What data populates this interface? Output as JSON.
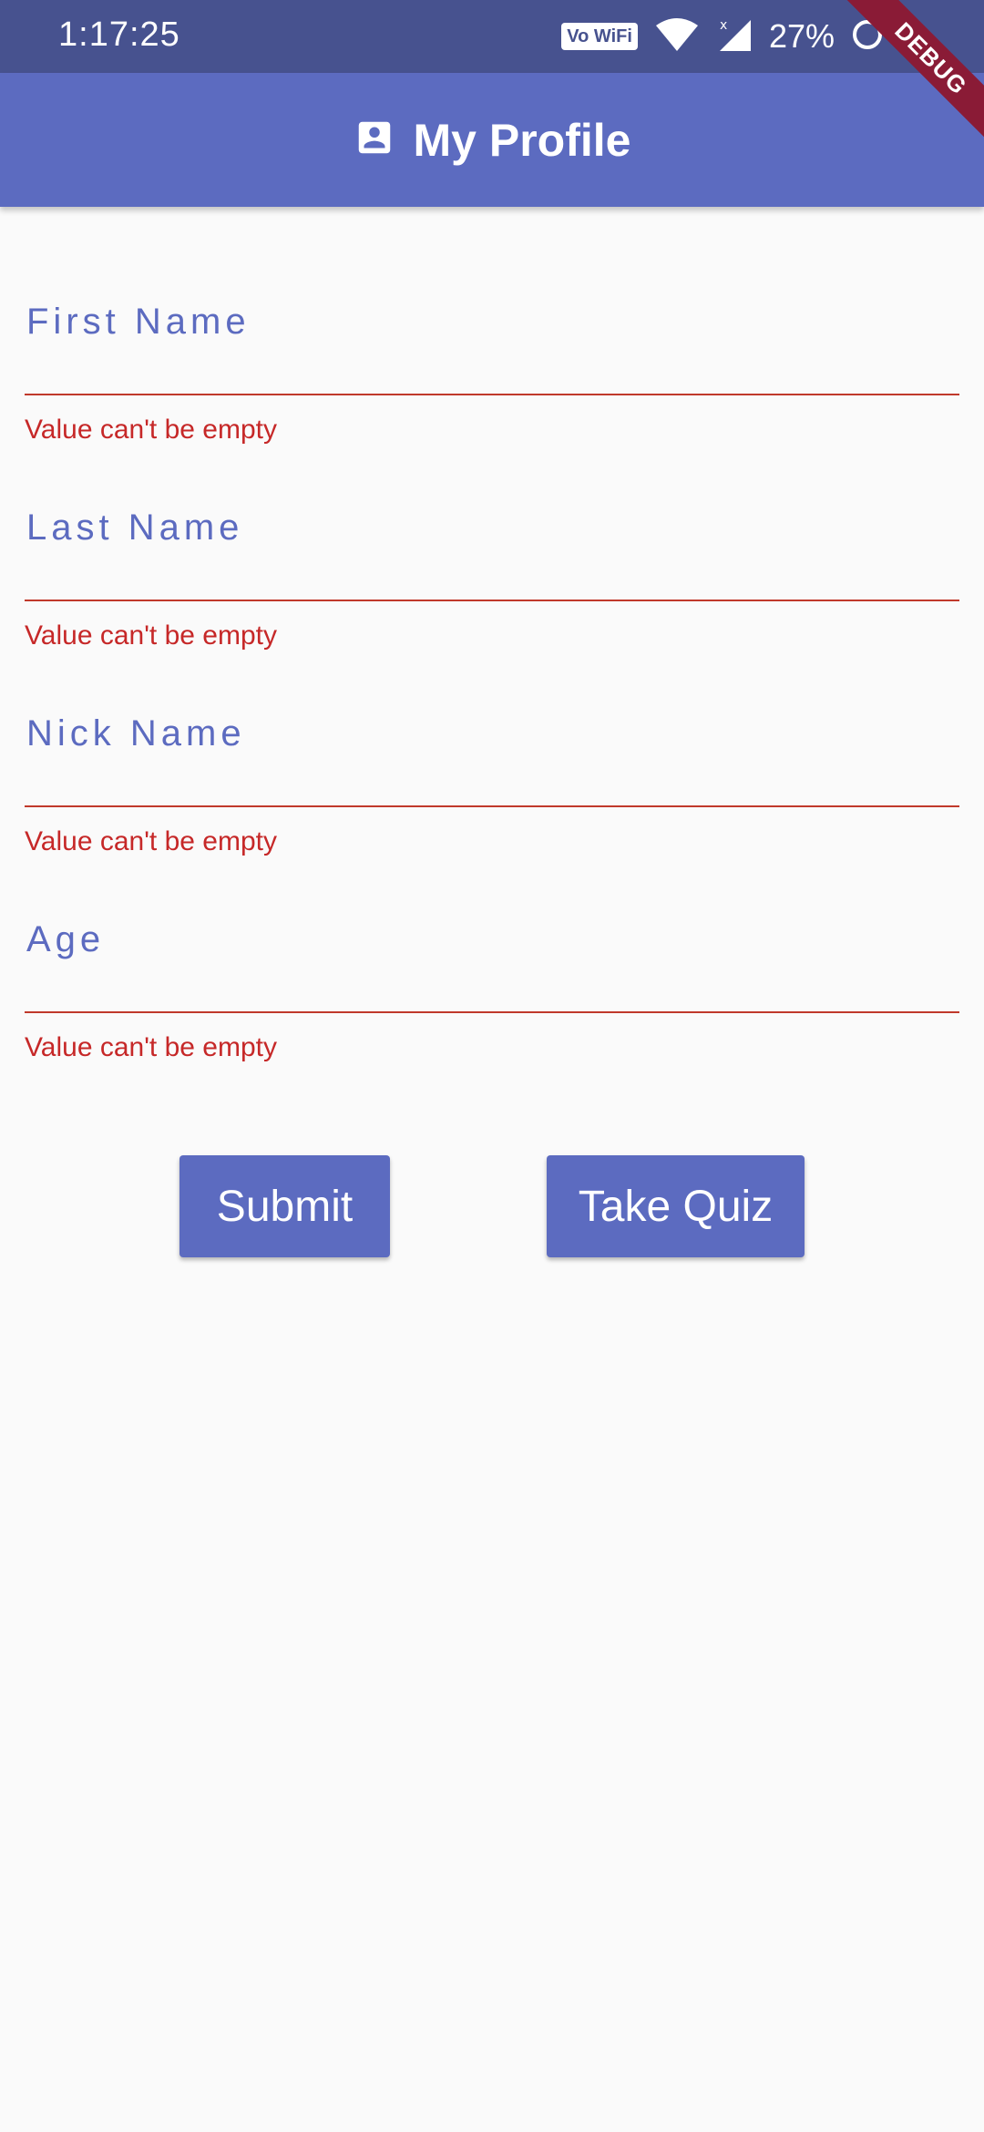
{
  "status_bar": {
    "time": "1:17:25",
    "vowifi": "Vo WiFi",
    "battery": "27%",
    "icons": [
      "wifi-icon",
      "signal-icon",
      "battery-icon"
    ]
  },
  "debug_banner": "DEBUG",
  "app_bar": {
    "title": "My Profile",
    "icon": "account-box-icon"
  },
  "form": {
    "fields": [
      {
        "label": "First Name",
        "value": "",
        "error": "Value can't be empty"
      },
      {
        "label": "Last Name",
        "value": "",
        "error": "Value can't be empty"
      },
      {
        "label": "Nick Name",
        "value": "",
        "error": "Value can't be empty"
      },
      {
        "label": "Age",
        "value": "",
        "error": "Value can't be empty"
      }
    ]
  },
  "actions": {
    "submit_label": "Submit",
    "quiz_label": "Take Quiz"
  },
  "colors": {
    "primary": "#5C6BC0",
    "status_bar": "#47528F",
    "error": "#C62828",
    "background": "#FAFAFA",
    "debug_banner": "#8A1B36"
  }
}
